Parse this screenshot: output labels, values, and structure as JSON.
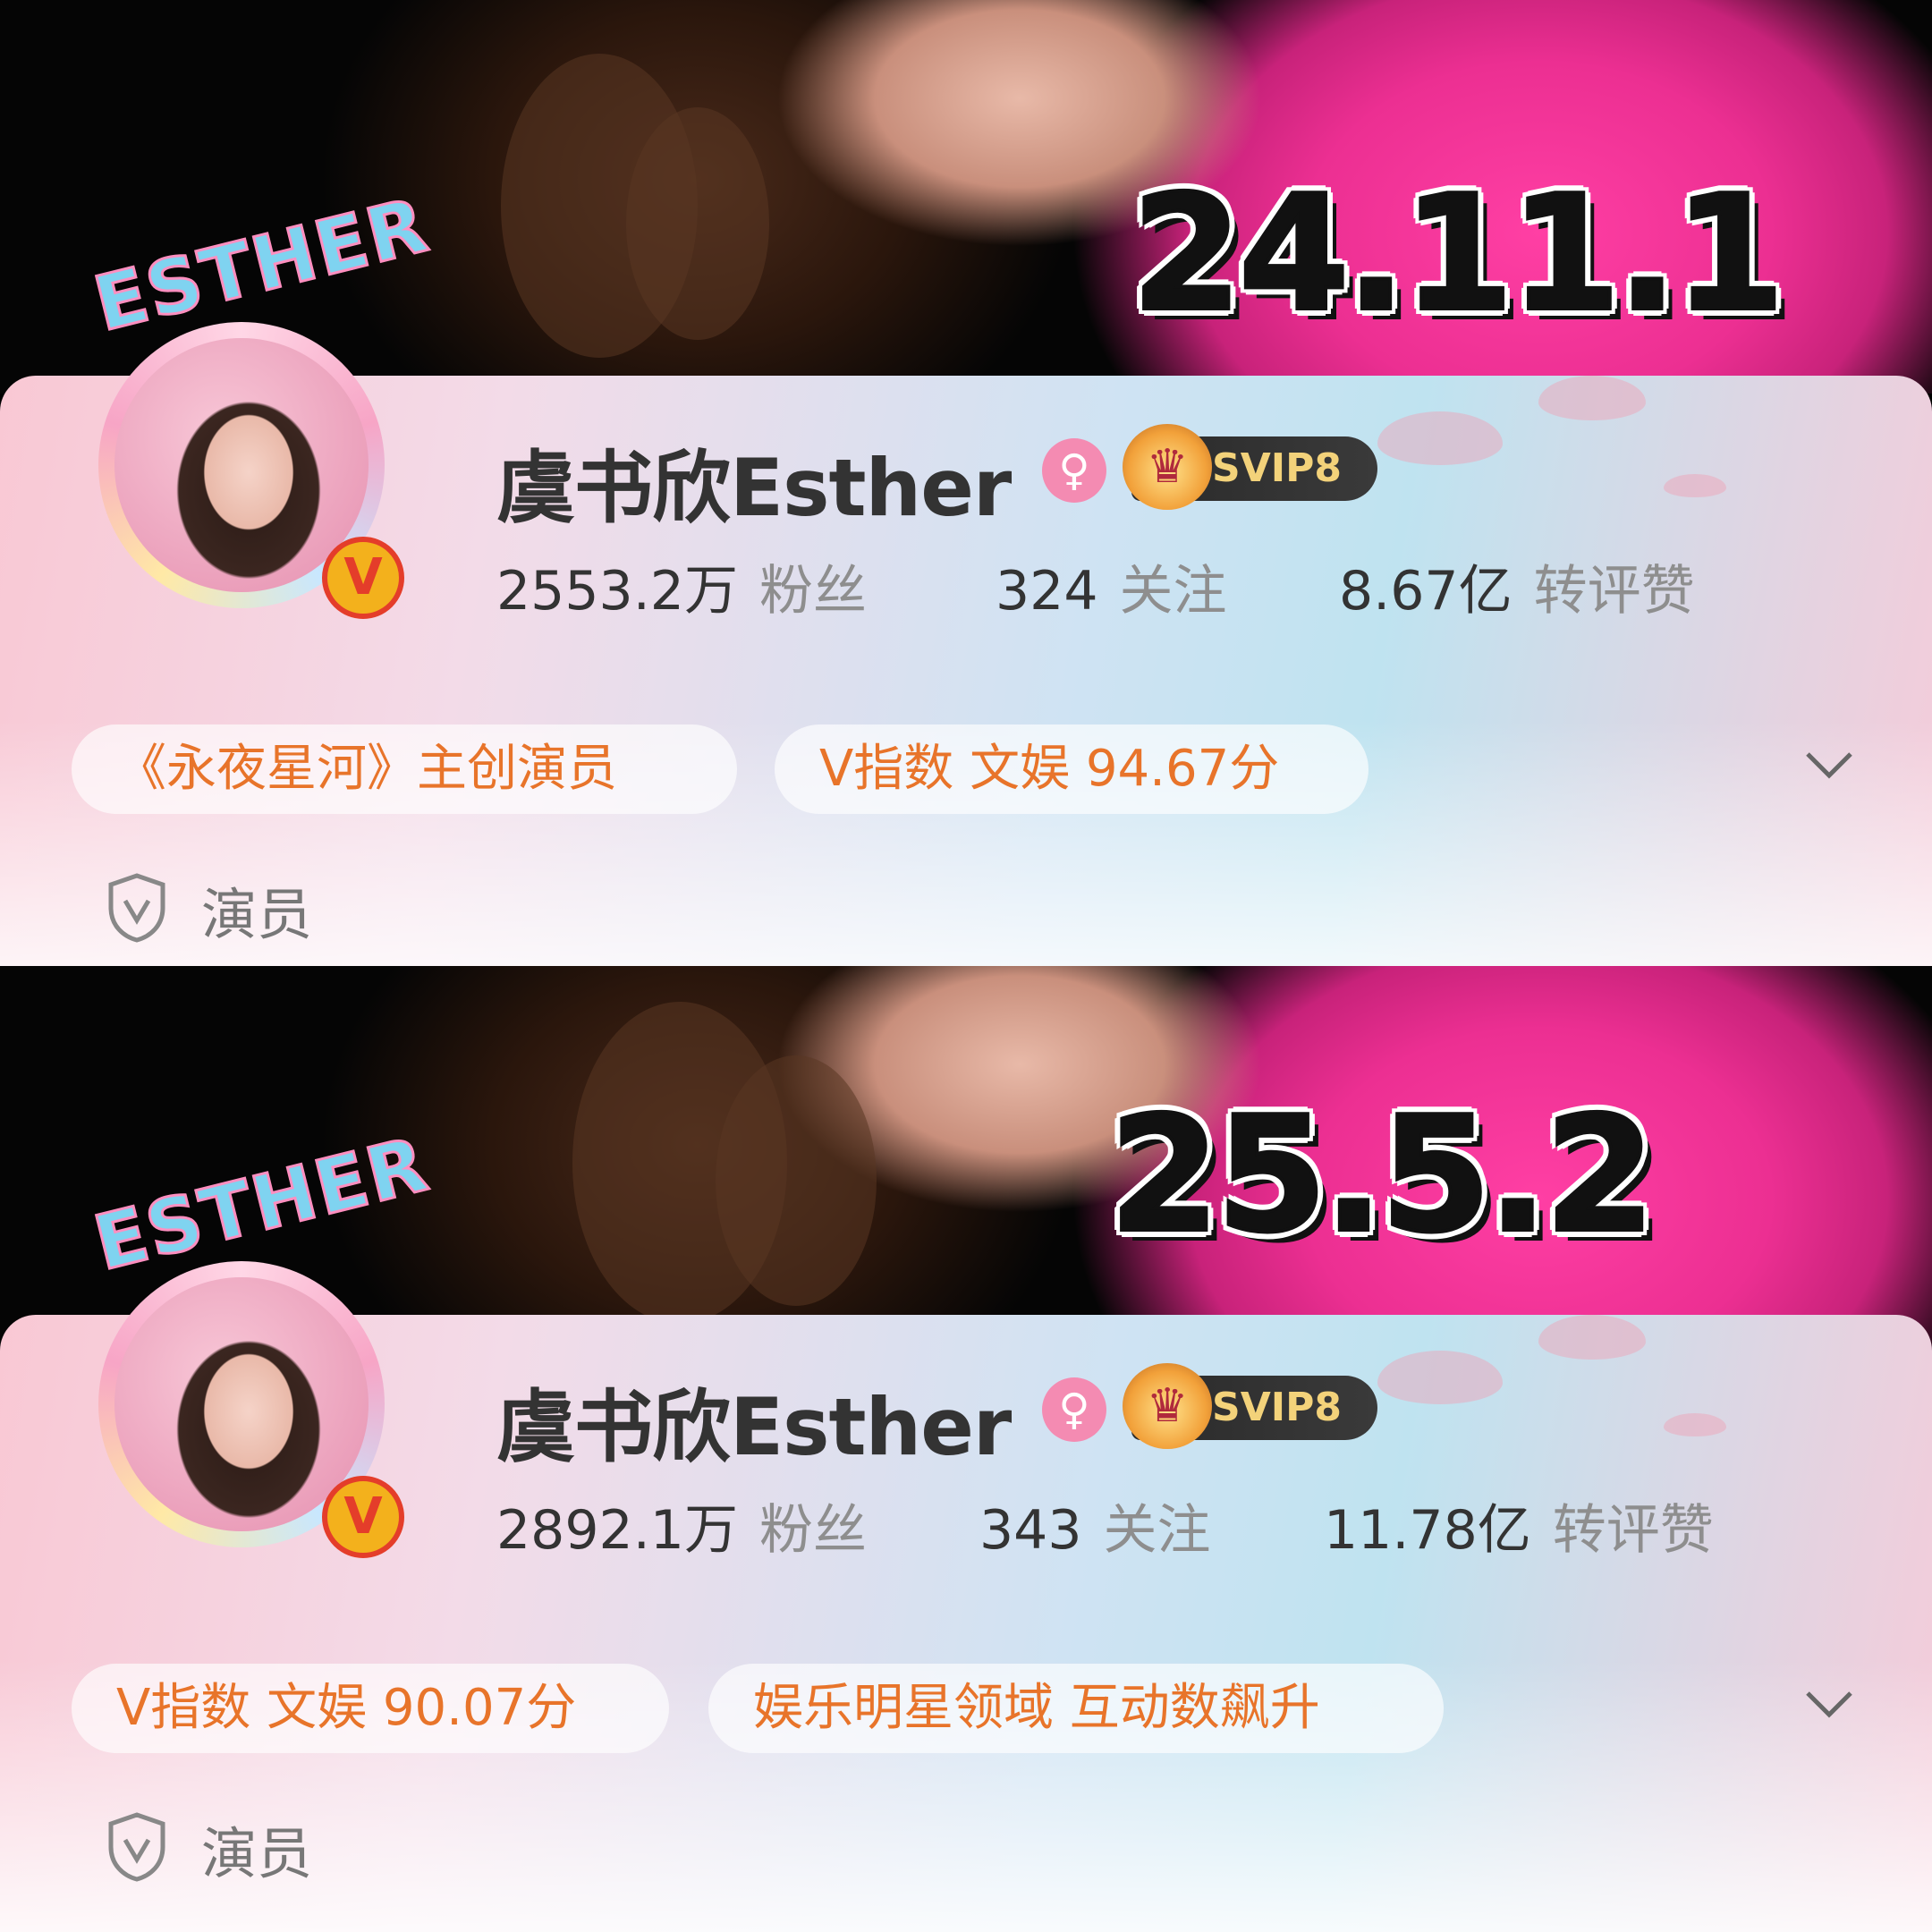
{
  "panels": [
    {
      "date_label": "24.11.1",
      "name": "虞书欣Esther",
      "logo_text": "ESTHER",
      "svip": "SVIP8",
      "fans_value": "2553.2万",
      "fans_label": "粉丝",
      "following_value": "324",
      "following_label": "关注",
      "interactions_value": "8.67亿",
      "interactions_label": "转评赞",
      "tags": [
        "《永夜星河》主创演员",
        "V指数 文娱 94.67分"
      ],
      "role": "演员"
    },
    {
      "date_label": "25.5.2",
      "name": "虞书欣Esther",
      "logo_text": "ESTHER",
      "svip": "SVIP8",
      "fans_value": "2892.1万",
      "fans_label": "粉丝",
      "following_value": "343",
      "following_label": "关注",
      "interactions_value": "11.78亿",
      "interactions_label": "转评赞",
      "tags": [
        "V指数 文娱 90.07分",
        "娱乐明星领域 互动数飙升"
      ],
      "role": "演员"
    }
  ],
  "icons": {
    "gender": "female-icon",
    "vip": "crown-icon",
    "verified": "v-badge-icon",
    "expand": "chevron-down-icon",
    "role": "shield-v-icon"
  },
  "colors": {
    "tag_text": "#e8742a",
    "gender_badge": "#f48bb2",
    "svip_text": "#f3d27a"
  }
}
